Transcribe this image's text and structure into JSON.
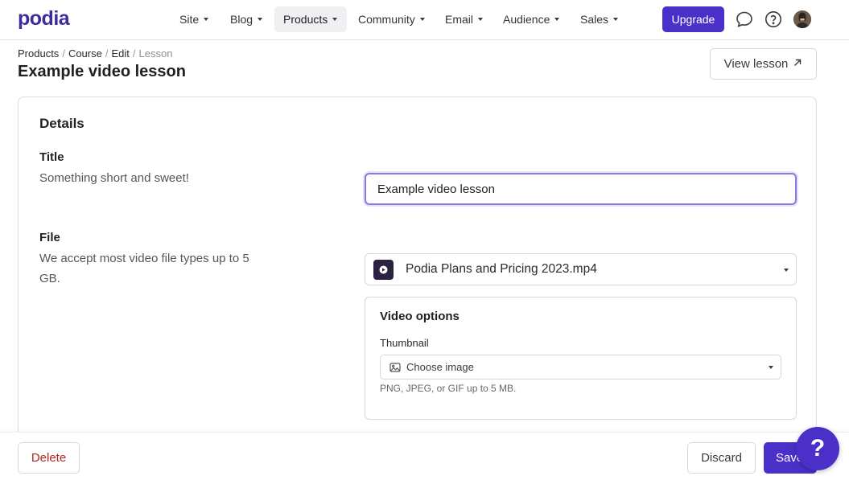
{
  "app": {
    "logo_text": "podia"
  },
  "nav": {
    "items": [
      {
        "label": "Site"
      },
      {
        "label": "Blog"
      },
      {
        "label": "Products",
        "active": true
      },
      {
        "label": "Community"
      },
      {
        "label": "Email"
      },
      {
        "label": "Audience"
      },
      {
        "label": "Sales"
      }
    ],
    "upgrade_label": "Upgrade",
    "icons": [
      "chat-bubble-icon",
      "help-circle-icon",
      "avatar"
    ]
  },
  "breadcrumb": {
    "items": [
      "Products",
      "Course",
      "Edit"
    ],
    "current": "Lesson"
  },
  "page": {
    "title": "Example video lesson",
    "view_lesson_label": "View lesson"
  },
  "details": {
    "heading": "Details",
    "title_field": {
      "label": "Title",
      "help": "Something short and sweet!",
      "value": "Example video lesson"
    },
    "file_field": {
      "label": "File",
      "help": "We accept most video file types up to 5 GB.",
      "selected_file": "Podia Plans and Pricing 2023.mp4"
    },
    "video_options": {
      "heading": "Video options",
      "thumbnail_label": "Thumbnail",
      "thumbnail_button": "Choose image",
      "thumbnail_hint": "PNG, JPEG, or GIF up to 5 MB."
    }
  },
  "footer": {
    "delete_label": "Delete",
    "discard_label": "Discard",
    "save_label": "Save"
  },
  "help_fab": {
    "label": "?"
  },
  "colors": {
    "accent": "#4b2fc9",
    "logo": "#3f2a9e",
    "danger": "#b3261e",
    "focus_ring": "#8a79e0"
  }
}
